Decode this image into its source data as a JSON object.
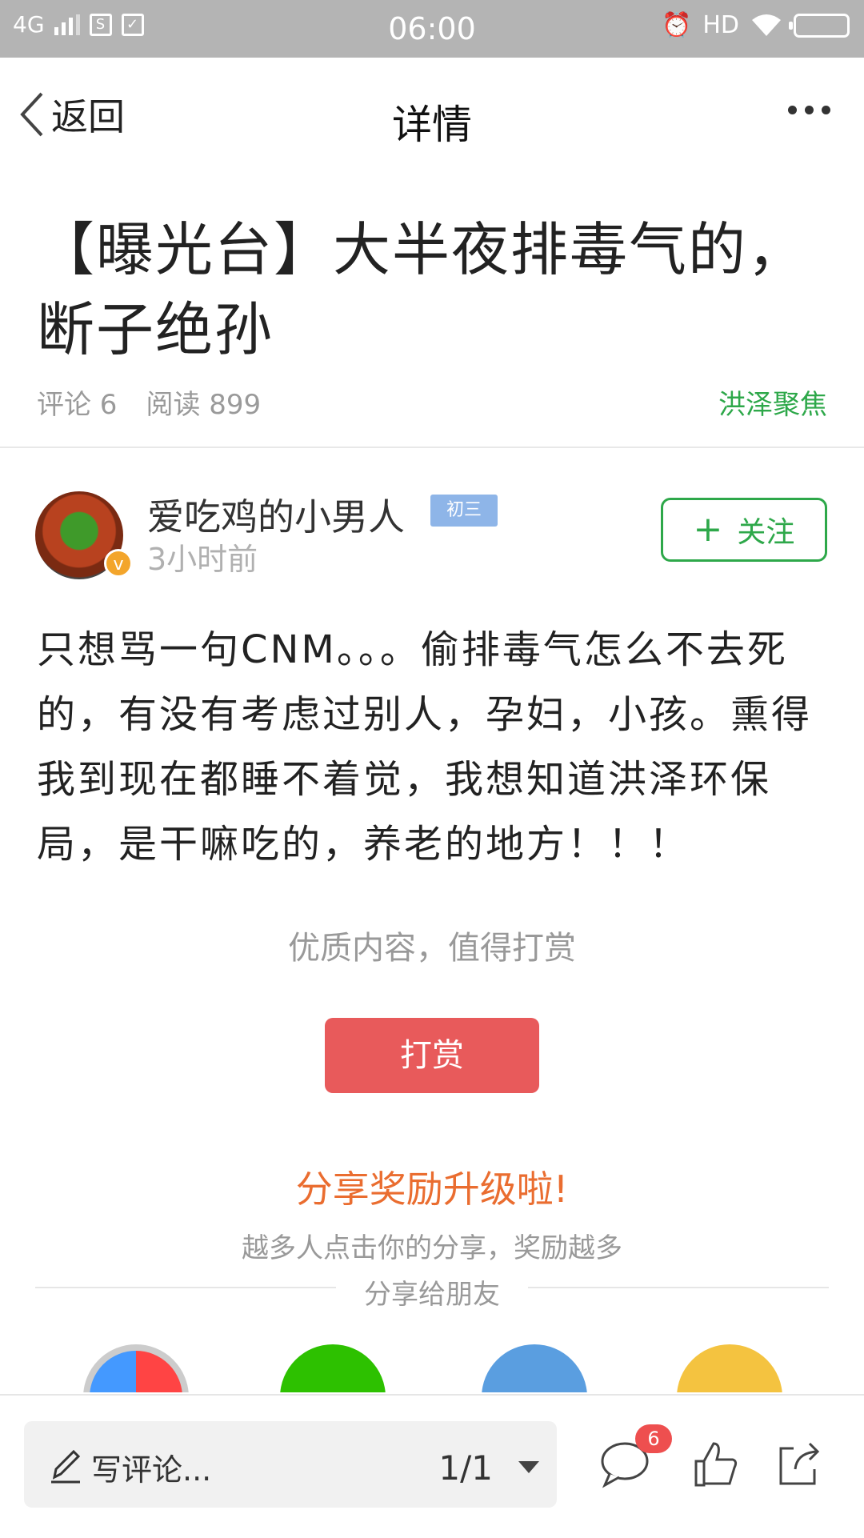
{
  "status_bar": {
    "network": "4G",
    "time": "06:00",
    "hd": "HD"
  },
  "nav": {
    "back_label": "返回",
    "title": "详情"
  },
  "article": {
    "title": "【曝光台】大半夜排毒气的，断子绝孙",
    "comments": "评论 6",
    "reads": "阅读 899",
    "source": "洪泽聚焦",
    "author": {
      "name": "爱吃鸡的小男人",
      "level": "初三",
      "time": "3小时前",
      "follow_label": "关注"
    },
    "body": "只想骂一句CNM。。。偷排毒气怎么不去死的，有没有考虑过别人，孕妇，小孩。熏得我到现在都睡不着觉，我想知道洪泽环保局，是干嘛吃的，养老的地方！！！"
  },
  "reward": {
    "hint": "优质内容，值得打赏",
    "button": "打赏"
  },
  "share": {
    "title": "分享奖励升级啦!",
    "subtitle": "越多人点击你的分享，奖励越多",
    "divider_label": "分享给朋友",
    "icons": [
      "moments-icon",
      "wechat-icon",
      "qq-icon",
      "qzone-icon"
    ]
  },
  "bottom_bar": {
    "comment_placeholder": "写评论...",
    "page_indicator": "1/1",
    "comment_count": "6"
  }
}
